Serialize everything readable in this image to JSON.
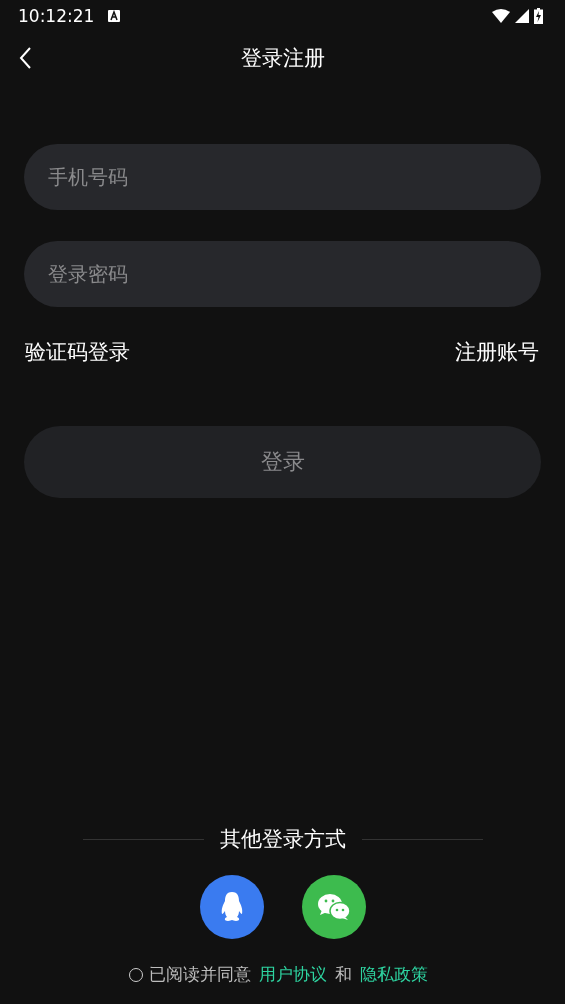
{
  "status_bar": {
    "time": "10:12:21"
  },
  "header": {
    "title": "登录注册"
  },
  "form": {
    "fields": [
      {
        "placeholder": "手机号码"
      },
      {
        "placeholder": "登录密码"
      }
    ],
    "links": [
      "验证码登录",
      "注册账号"
    ],
    "submit": "登录"
  },
  "other_login": {
    "title": "其他登录方式",
    "methods": [
      {
        "kind": "qq",
        "color": "#3a7bf0"
      },
      {
        "kind": "wechat",
        "color": "#3dbb4e"
      }
    ]
  },
  "agreement": {
    "checked": false,
    "text": "已阅读并同意",
    "links": [
      "用户协议",
      "隐私政策"
    ],
    "joiner": "和"
  }
}
